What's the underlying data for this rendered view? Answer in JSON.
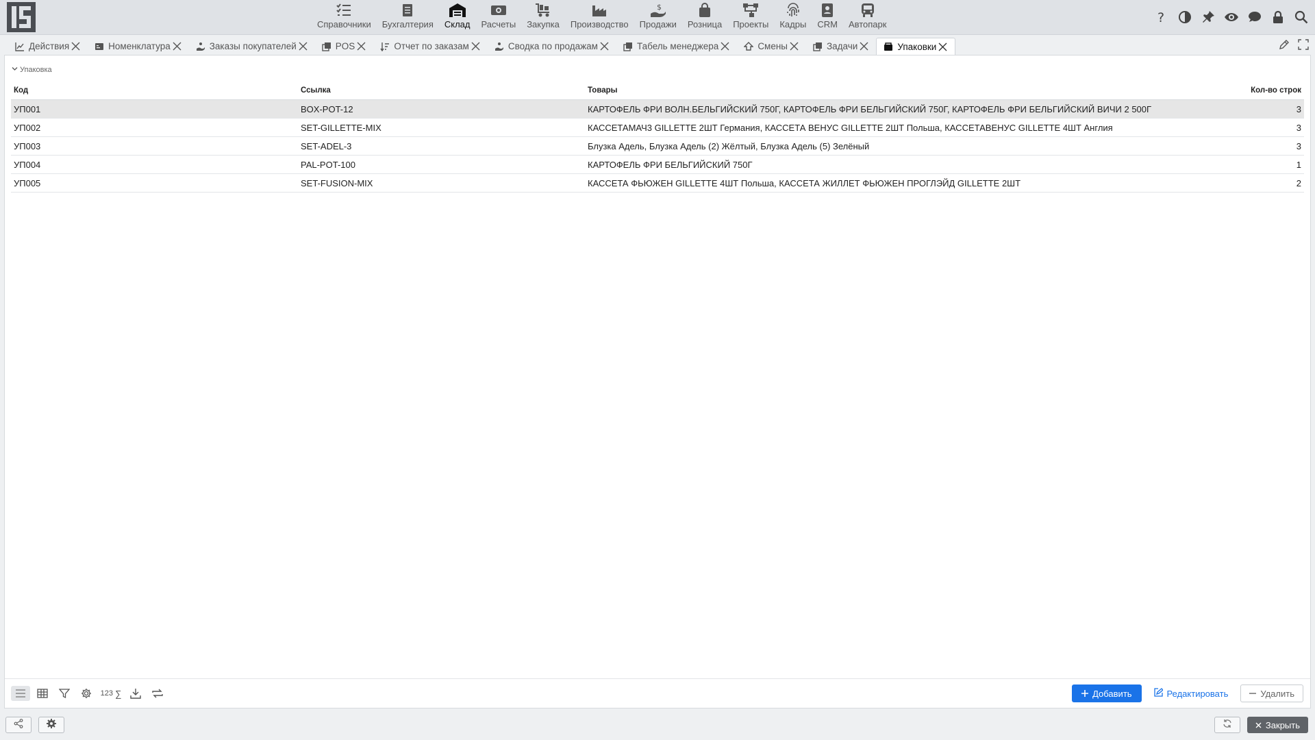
{
  "nav": {
    "items": [
      {
        "label": "Справочники",
        "icon": "checklist-icon"
      },
      {
        "label": "Бухгалтерия",
        "icon": "ledger-icon"
      },
      {
        "label": "Склад",
        "icon": "warehouse-icon",
        "active": true
      },
      {
        "label": "Расчеты",
        "icon": "money-icon"
      },
      {
        "label": "Закупка",
        "icon": "cart-icon"
      },
      {
        "label": "Производство",
        "icon": "factory-icon"
      },
      {
        "label": "Продажи",
        "icon": "hand-coin-icon"
      },
      {
        "label": "Розница",
        "icon": "shopping-bag-icon"
      },
      {
        "label": "Проекты",
        "icon": "hierarchy-icon"
      },
      {
        "label": "Кадры",
        "icon": "fingerprint-icon"
      },
      {
        "label": "CRM",
        "icon": "contact-icon"
      },
      {
        "label": "Автопарк",
        "icon": "bus-icon"
      }
    ]
  },
  "tabs": [
    {
      "label": "Действия",
      "icon": "chart-line-icon"
    },
    {
      "label": "Номенклатура",
      "icon": "catalog-icon"
    },
    {
      "label": "Заказы покупателей",
      "icon": "hand-coin-icon"
    },
    {
      "label": "POS",
      "icon": "copy-icon"
    },
    {
      "label": "Отчет по заказам",
      "icon": "sort-icon"
    },
    {
      "label": "Сводка по продажам",
      "icon": "hand-coin-icon"
    },
    {
      "label": "Табель менеджера",
      "icon": "copy-icon"
    },
    {
      "label": "Смены",
      "icon": "shift-icon"
    },
    {
      "label": "Задачи",
      "icon": "copy-icon"
    },
    {
      "label": "Упаковки",
      "icon": "box-icon",
      "active": true
    }
  ],
  "group": {
    "title": "Упаковка"
  },
  "table": {
    "columns": [
      "Код",
      "Ссылка",
      "Товары",
      "Кол-во строк"
    ],
    "rows": [
      {
        "code": "УП001",
        "ref": "BOX-POT-12",
        "items": "КАРТОФЕЛЬ ФРИ ВОЛН.БЕЛЬГИЙСКИЙ 750Г, КАРТОФЕЛЬ ФРИ БЕЛЬГИЙСКИЙ 750Г, КАРТОФЕЛЬ ФРИ БЕЛЬГИЙСКИЙ ВИЧИ 2 500Г",
        "count": "3"
      },
      {
        "code": "УП002",
        "ref": "SET-GILLETTE-MIX",
        "items": "КАССЕТАМАЧ3 GILLETTE 2ШТ Германия, КАССЕТА ВЕНУС GILLETTE 2ШТ Польша, КАССЕТАВЕНУС GILLETTE 4ШТ Англия",
        "count": "3"
      },
      {
        "code": "УП003",
        "ref": "SET-ADEL-3",
        "items": "Блузка Адель, Блузка Адель (2) Жёлтый, Блузка Адель (5) Зелёный",
        "count": "3"
      },
      {
        "code": "УП004",
        "ref": "PAL-POT-100",
        "items": "КАРТОФЕЛЬ ФРИ БЕЛЬГИЙСКИЙ 750Г",
        "count": "1"
      },
      {
        "code": "УП005",
        "ref": "SET-FUSION-MIX",
        "items": "КАССЕТА ФЬЮЖЕН GILLETTE 4ШТ Польша, КАССЕТА ЖИЛЛЕТ ФЬЮЖЕН ПРОГЛЭЙД GILLETTE 2ШТ",
        "count": "2"
      }
    ]
  },
  "footer": {
    "digits_label": "123",
    "sum_label": "∑",
    "add_label": "Добавить",
    "edit_label": "Редактировать",
    "delete_label": "Удалить"
  },
  "bottom": {
    "close_label": "Закрыть"
  },
  "colors": {
    "accent": "#1a73e8"
  }
}
